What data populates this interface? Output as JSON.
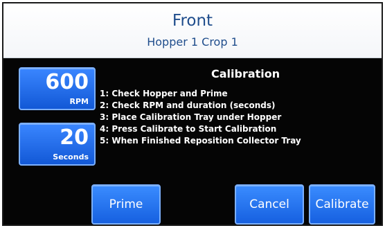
{
  "header": {
    "title": "Front",
    "subtitle": "Hopper 1 Crop 1"
  },
  "rpm": {
    "value": "600",
    "unit": "RPM"
  },
  "duration": {
    "value": "20",
    "unit": "Seconds"
  },
  "calibration": {
    "title": "Calibration",
    "steps": [
      "1: Check Hopper and Prime",
      "2: Check RPM and duration (seconds)",
      "3: Place Calibration Tray under Hopper",
      "4: Press Calibrate to Start Calibration",
      "5: When Finished Reposition Collector Tray"
    ]
  },
  "buttons": {
    "prime": "Prime",
    "cancel": "Cancel",
    "calibrate": "Calibrate"
  },
  "colors": {
    "button_blue": "#1a66e6",
    "header_text": "#1f4d8c",
    "background": "#050505"
  }
}
